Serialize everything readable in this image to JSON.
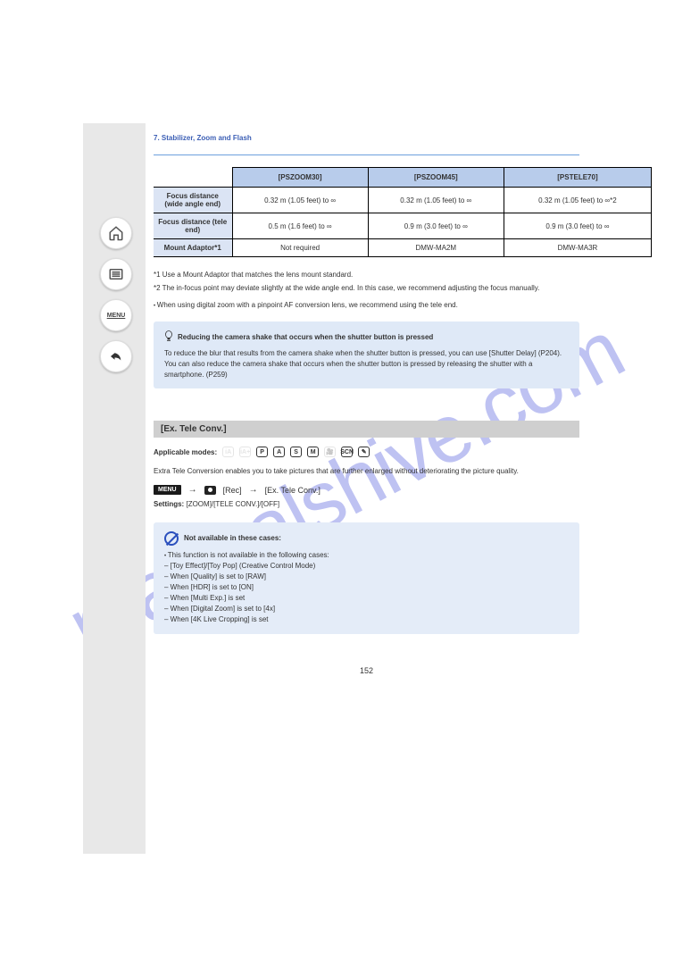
{
  "watermark": "manualshive.com",
  "breadcrumb": "7. Stabilizer, Zoom and Flash",
  "table": {
    "headers": [
      "",
      "[PSZOOM30]",
      "[PSZOOM45]",
      "[PSTELE70]"
    ],
    "rows": [
      {
        "h": "Focus distance (wide angle end)",
        "a": "0.32 m (1.05 feet) to ∞",
        "b": "0.32 m (1.05 feet) to ∞",
        "c": "0.32 m (1.05 feet) to ∞*2"
      },
      {
        "h": "Focus distance (tele end)",
        "a": "0.5 m (1.6 feet) to ∞",
        "b": "0.9 m (3.0 feet) to ∞",
        "c": "0.9 m (3.0 feet) to ∞"
      },
      {
        "h": "Mount Adaptor*1",
        "a": "Not required",
        "b": "DMW-MA2M",
        "c": "DMW-MA3R"
      }
    ]
  },
  "footnotes": [
    "*1 Use a Mount Adaptor that matches the lens mount standard.",
    "*2 The in-focus point may deviate slightly at the wide angle end. In this case, we recommend adjusting the focus manually."
  ],
  "footnote_extra": "When using digital zoom with a pinpoint AF conversion lens, we recommend using the tele end.",
  "tip": {
    "title": "Reducing the camera shake that occurs when the shutter button is pressed",
    "body": [
      "To reduce the blur that results from the camera shake when the shutter button is pressed, you can use [Shutter Delay] (P204).",
      "You can also reduce the camera shake that occurs when the shutter button is pressed by releasing the shutter with a smartphone. (P259)"
    ]
  },
  "section": {
    "title": "[Ex. Tele Conv.]",
    "modes_label": "Applicable modes:",
    "desc": "Extra Tele Conversion enables you to take pictures that are further enlarged without deteriorating the picture quality.",
    "menu_label": "MENU",
    "menu_path_parts": [
      "[Rec]",
      "[Ex. Tele Conv.]"
    ],
    "settings_label": "Settings:",
    "settings_value": "[ZOOM]/[TELE CONV.]/[OFF]"
  },
  "notavail": {
    "title": "Not available in these cases:",
    "items": [
      "This function is not available in the following cases:",
      "[Toy Effect]/[Toy Pop] (Creative Control Mode)",
      "When [Quality] is set to [RAW]",
      "When [HDR] is set to [ON]",
      "When [Multi Exp.] is set",
      "When [Digital Zoom] is set to [4x]",
      "When [4K Live Cropping] is set"
    ]
  },
  "page": "152"
}
